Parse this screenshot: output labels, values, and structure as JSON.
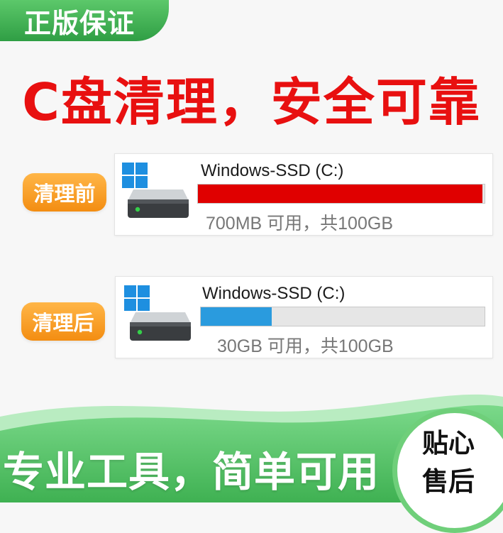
{
  "badge": {
    "text": "正版保证"
  },
  "headline": {
    "text": "C盘清理，安全可靠"
  },
  "before": {
    "tag": "清理前",
    "drive_name": "Windows-SSD (C:)",
    "usage_text": "700MB 可用，共100GB",
    "used_fraction": 0.993,
    "bar_color": "#e00000"
  },
  "after": {
    "tag": "清理后",
    "drive_name": "Windows-SSD (C:)",
    "usage_text": "30GB 可用，共100GB",
    "used_fraction": 0.25,
    "bar_color": "#2a9bde"
  },
  "footer": {
    "slogan": "专业工具，简单可用",
    "service_line1": "贴心",
    "service_line2": "售后"
  },
  "colors": {
    "headline_red": "#e81010",
    "brand_green": "#2f9e44",
    "tag_orange": "#f38d12",
    "windows_blue": "#1e8fe0"
  },
  "icons": [
    "windows-logo-icon",
    "hard-drive-icon"
  ]
}
